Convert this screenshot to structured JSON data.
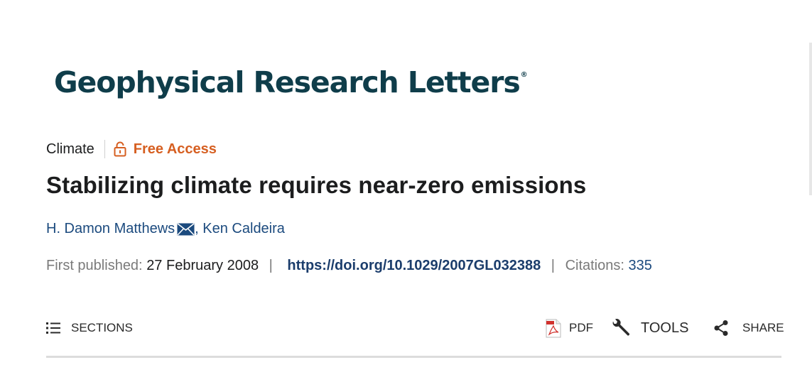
{
  "journal": {
    "name": "Geophysical Research Letters",
    "reg_mark": "®"
  },
  "article": {
    "subject": "Climate",
    "access_label": "Free Access",
    "title": "Stabilizing climate requires near-zero emissions",
    "authors": [
      {
        "name": "H. Damon Matthews",
        "has_mail": true
      },
      {
        "name": ", Ken Caldeira",
        "has_mail": false
      }
    ],
    "published_label": "First published:",
    "published_date": "27 February 2008",
    "separator": "|",
    "doi": "https://doi.org/10.1029/2007GL032388",
    "citations_label": "Citations:",
    "citations_count": "335"
  },
  "toolbar": {
    "sections_label": "SECTIONS",
    "pdf_label": "PDF",
    "tools_label": "TOOLS",
    "share_label": "SHARE"
  },
  "colors": {
    "logo": "#0f3d4a",
    "access": "#d65f21",
    "link": "#1b4a7e",
    "doi": "#1b3d6c"
  },
  "icons": [
    "lock-icon",
    "mail-icon",
    "list-icon",
    "pdf-icon",
    "wrench-icon",
    "share-icon"
  ]
}
